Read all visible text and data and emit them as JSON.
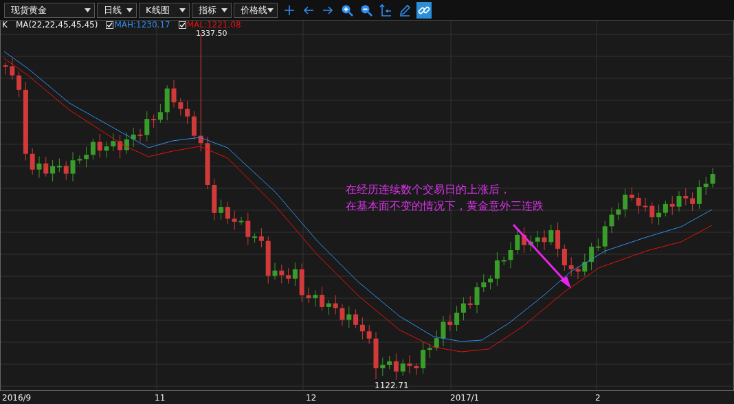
{
  "toolbar": {
    "dropdowns": [
      {
        "label": "现货黄金"
      },
      {
        "label": "日线"
      },
      {
        "label": "K线图"
      },
      {
        "label": "指标"
      },
      {
        "label": "价格线"
      }
    ],
    "tools": [
      {
        "kind": "crosshair",
        "selected": false
      },
      {
        "kind": "back",
        "selected": false
      },
      {
        "kind": "forward",
        "selected": false
      },
      {
        "kind": "zoom-in",
        "selected": false
      },
      {
        "kind": "zoom-out",
        "selected": false
      },
      {
        "kind": "axis",
        "selected": false
      },
      {
        "kind": "pencil",
        "selected": false
      },
      {
        "kind": "link",
        "selected": true
      }
    ]
  },
  "legend": {
    "symbol": "K",
    "indicator": "MA(22,22,45,45,45)",
    "lines": [
      {
        "label": "MAH:1230.17",
        "checked": true,
        "color": "#2f8ff0"
      },
      {
        "label": "MAL:1221.08",
        "checked": true,
        "color": "#e81010"
      }
    ]
  },
  "chart": {
    "high_label": "1337.50",
    "low_label": "1122.71",
    "annotation": [
      "在经历连续数个交易日的上涨后，",
      "在基本面不变的情况下，黄金意外三连跌"
    ],
    "x_labels": [
      "2016/9",
      "11",
      "12",
      "2017/1",
      "2"
    ]
  }
}
